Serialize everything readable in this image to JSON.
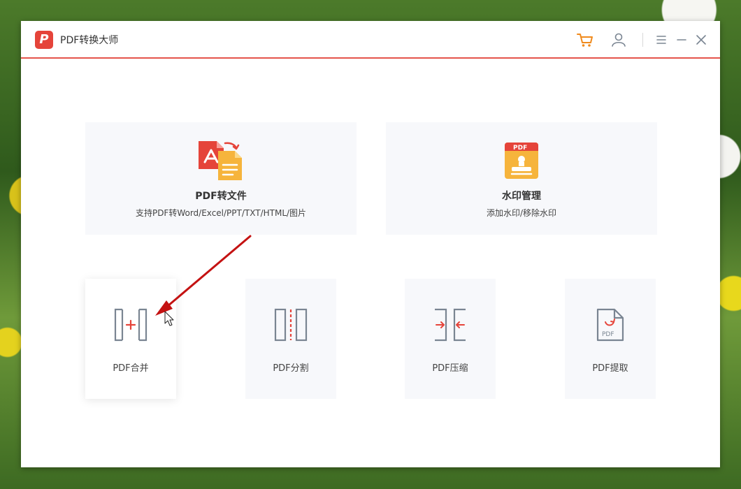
{
  "app": {
    "title": "PDF转换大师",
    "logo_letter": "P"
  },
  "toolbar": {
    "icons": [
      "cart-icon",
      "user-icon",
      "menu-icon",
      "minimize-icon",
      "close-icon"
    ],
    "accent_color": "#f08a1c"
  },
  "features": [
    {
      "title": "PDF转文件",
      "subtitle": "支持PDF转Word/Excel/PPT/TXT/HTML/图片",
      "icon": "pdf-convert-icon"
    },
    {
      "title": "水印管理",
      "subtitle": "添加水印/移除水印",
      "icon": "watermark-icon",
      "icon_text": "PDF"
    }
  ],
  "tools": [
    {
      "label": "PDF合并",
      "icon": "merge-icon"
    },
    {
      "label": "PDF分割",
      "icon": "split-icon"
    },
    {
      "label": "PDF压缩",
      "icon": "compress-icon"
    },
    {
      "label": "PDF提取",
      "icon": "extract-icon",
      "icon_text": "PDF"
    }
  ],
  "colors": {
    "brand_red": "#e5443a",
    "card_bg": "#f7f8fb",
    "annotation_arrow": "#d11a1a"
  }
}
